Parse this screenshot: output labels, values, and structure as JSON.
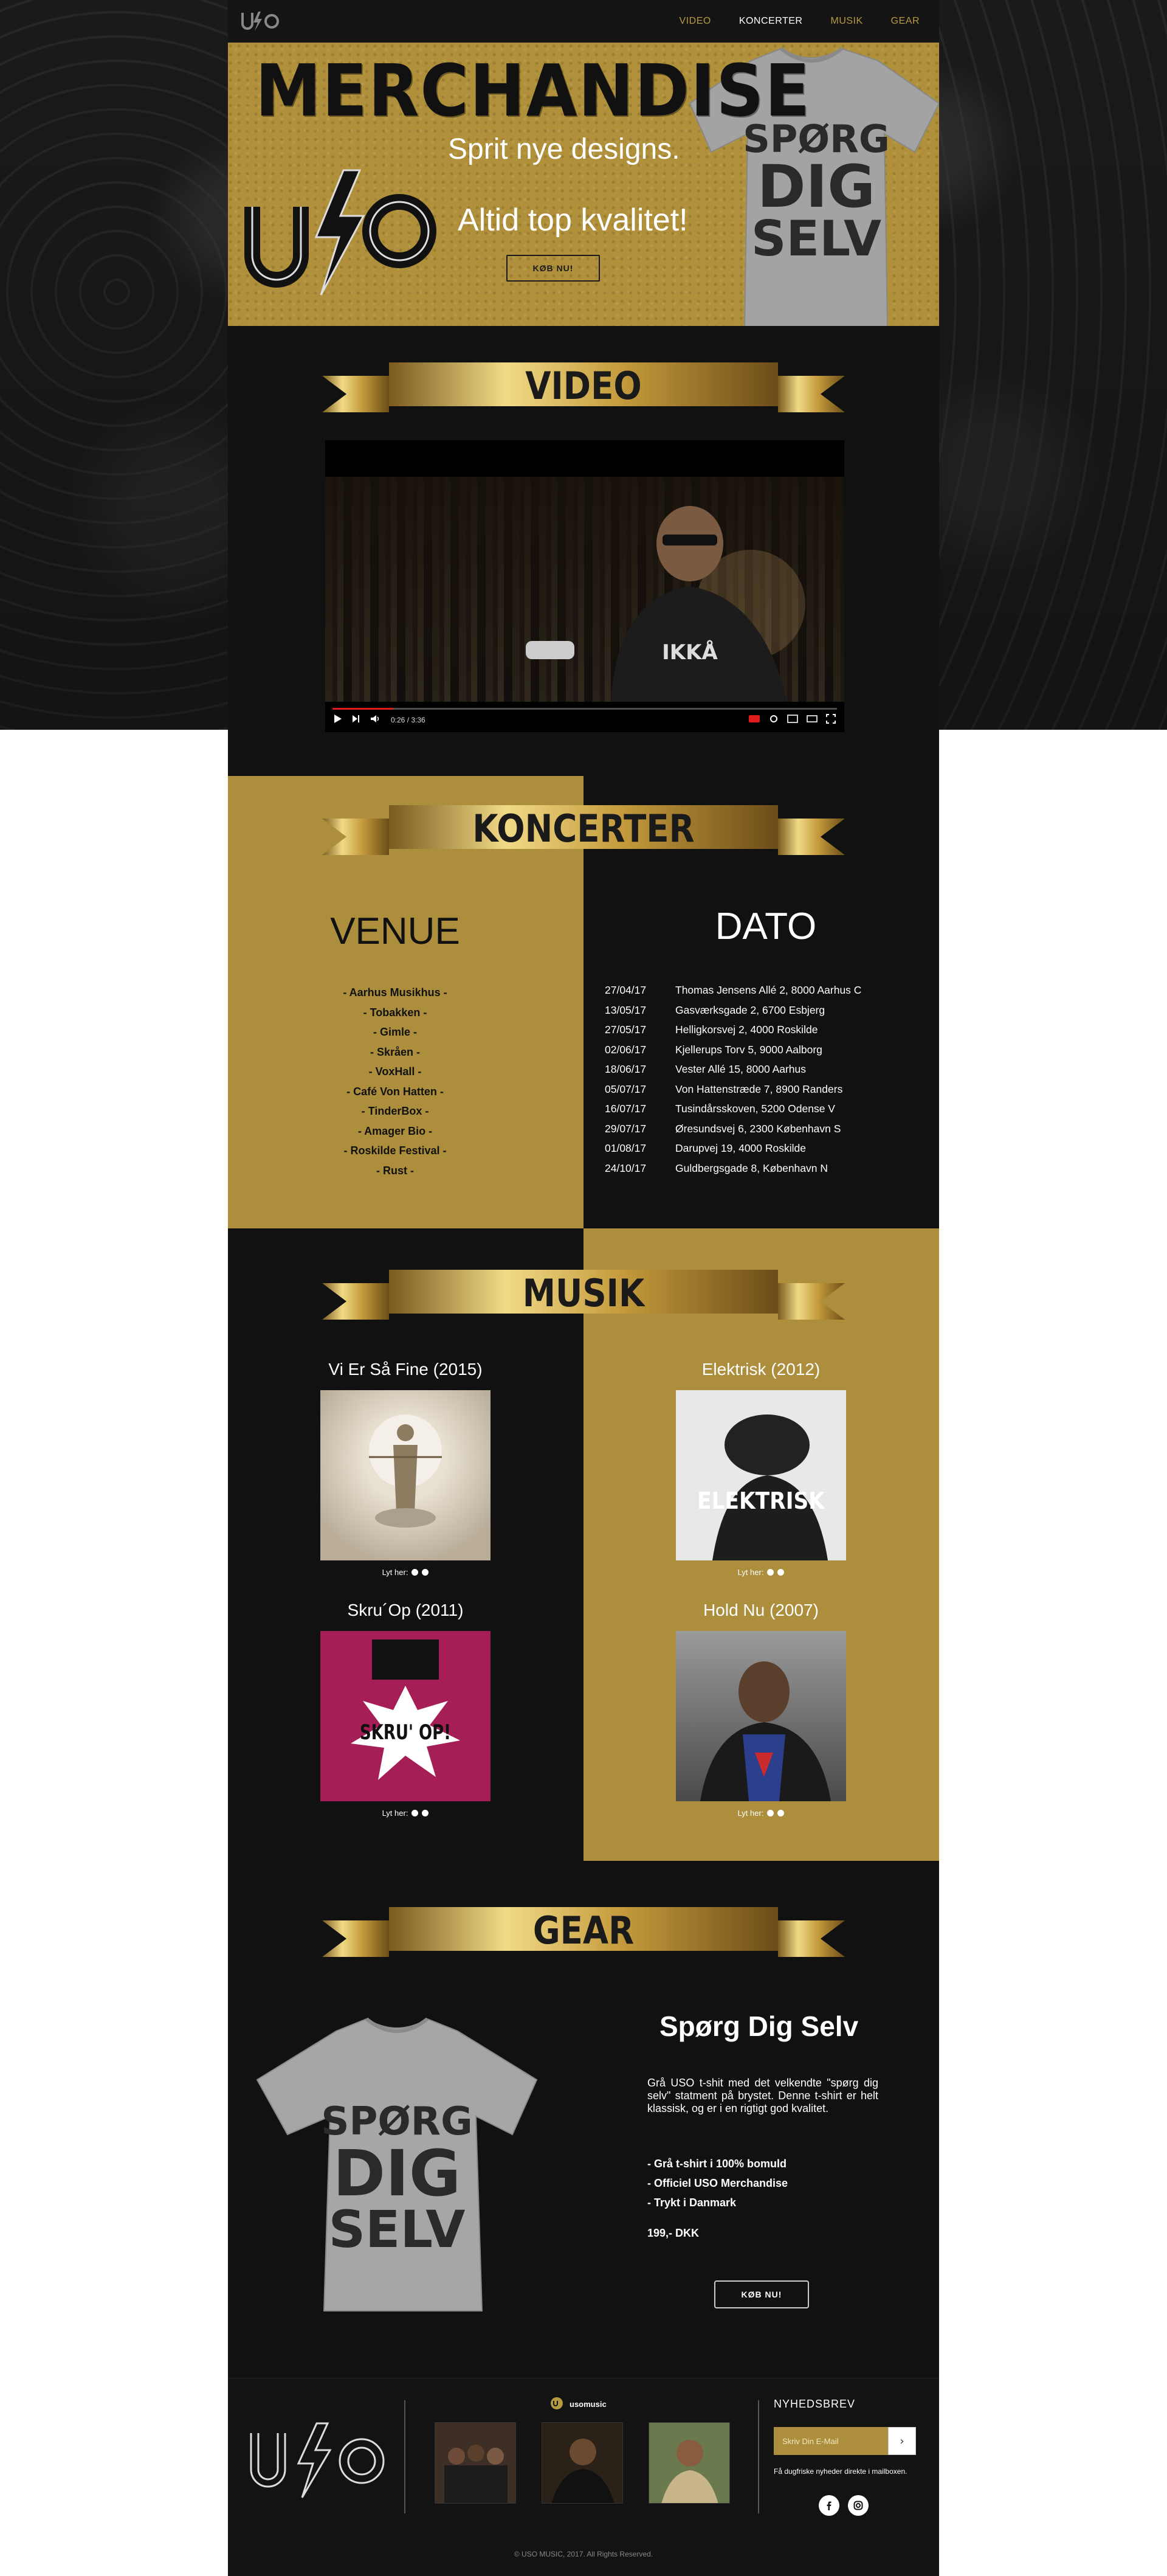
{
  "nav": {
    "logo_alt": "USO",
    "links": [
      {
        "label": "VIDEO",
        "active": false
      },
      {
        "label": "KONCERTER",
        "active": true
      },
      {
        "label": "MUSIK",
        "active": false
      },
      {
        "label": "GEAR",
        "active": false
      }
    ]
  },
  "hero": {
    "title": "MERCHANDISE",
    "line1": "Sprit nye designs.",
    "line2": "Altid top kvalitet!",
    "button": "KØB NU!",
    "shirt_text": [
      "SPØRG",
      "DIG",
      "SELV"
    ]
  },
  "video": {
    "heading": "VIDEO",
    "time": "0:26 / 3:36",
    "progress": 0.12,
    "shirt_print": "IKKÅ"
  },
  "concerts": {
    "heading": "KONCERTER",
    "venue_heading": "VENUE",
    "date_heading": "DATO",
    "venues": [
      "- Aarhus Musikhus -",
      "- Tobakken -",
      "- Gimle -",
      "- Skråen -",
      "- VoxHall -",
      "- Café Von Hatten -",
      "- TinderBox -",
      "- Amager Bio -",
      "- Roskilde Festival -",
      "- Rust -"
    ],
    "dates": [
      {
        "date": "27/04/17",
        "address": "Thomas Jensens Allé 2, 8000 Aarhus C"
      },
      {
        "date": "13/05/17",
        "address": "Gasværksgade 2, 6700 Esbjerg"
      },
      {
        "date": "27/05/17",
        "address": "Helligkorsvej 2, 4000 Roskilde"
      },
      {
        "date": "02/06/17",
        "address": "Kjellerups Torv 5, 9000 Aalborg"
      },
      {
        "date": "18/06/17",
        "address": "Vester Allé 15, 8000 Aarhus"
      },
      {
        "date": "05/07/17",
        "address": "Von Hattenstræde 7, 8900 Randers"
      },
      {
        "date": "16/07/17",
        "address": "Tusindårsskoven, 5200 Odense V"
      },
      {
        "date": "29/07/17",
        "address": "Øresundsvej 6, 2300 København S"
      },
      {
        "date": "01/08/17",
        "address": "Darupvej 19, 4000 Roskilde"
      },
      {
        "date": "24/10/17",
        "address": "Guldbergsgade 8, København N"
      }
    ]
  },
  "music": {
    "heading": "MUSIK",
    "listen_label": "Lyt her:",
    "albums": [
      {
        "title": "Vi Er Så Fine (2015)"
      },
      {
        "title": "Elektrisk (2012)",
        "cover_text": "ELEKTRISK"
      },
      {
        "title": "Skru´Op (2011)",
        "cover_text": "SKRU' OP!"
      },
      {
        "title": "Hold Nu (2007)"
      }
    ]
  },
  "gear": {
    "heading": "GEAR",
    "product_title": "Spørg Dig Selv",
    "description": "Grå USO t-shit med det velkendte \"spørg dig selv\" statment på brystet. Denne t-shirt er helt klassisk, og er i en rigtigt god kvalitet.",
    "features": [
      "- Grå t-shirt i 100% bomuld",
      "- Officiel USO Merchandise",
      "- Trykt i Danmark"
    ],
    "price": "199,- DKK",
    "button": "KØB NU!",
    "shirt_text": [
      "SPØRG",
      "DIG",
      "SELV"
    ]
  },
  "footer": {
    "instagram_handle": "usomusic",
    "newsletter_heading": "NYHEDSBREV",
    "email_placeholder": "Skriv Din E-Mail",
    "submit_icon": "›",
    "hint": "Få dugfriske nyheder direkte i mailboxen.",
    "social": [
      "facebook-icon",
      "instagram-icon"
    ],
    "copyright": "© USO MUSIC, 2017. All Rights Reserved."
  },
  "colors": {
    "gold": "#ad8e3d",
    "dark": "#111111",
    "nav_link": "#b59a40"
  }
}
